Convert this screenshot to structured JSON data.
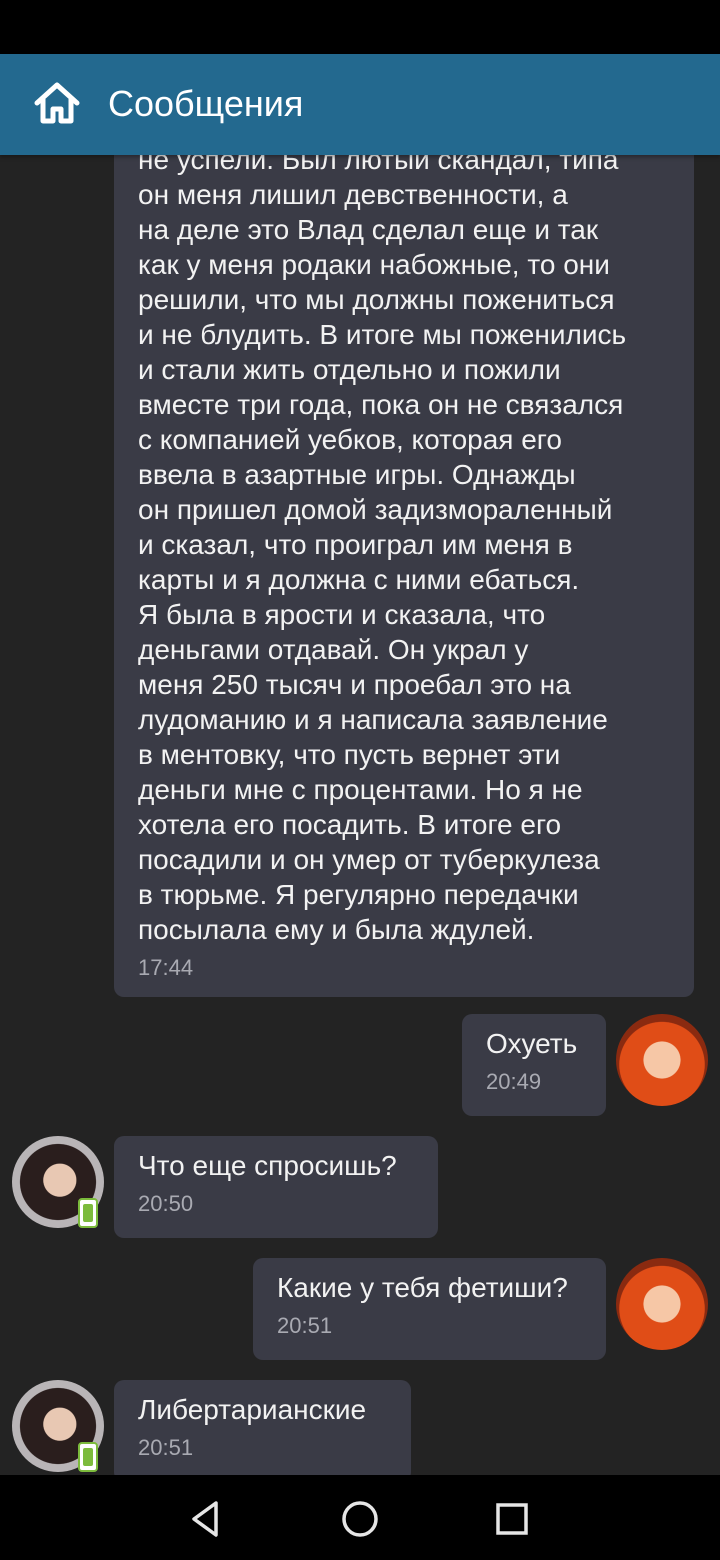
{
  "app_bar": {
    "title": "Сообщения",
    "icon": "home-icon"
  },
  "messages": [
    {
      "sender": "other",
      "text": "не успели. Был лютый скандал, типа\nон меня лишил девственности, а\nна деле это Влад сделал еще и так\nкак у меня родаки набожные, то они\nрешили, что мы должны пожениться\nи не блудить. В итоге мы поженились\nи стали жить отдельно и пожили\nвместе три года, пока он не связался\nс компанией уебков, которая его\nввела в азартные игры. Однажды\nон пришел домой задизмораленный\nи сказал, что проиграл им меня в\nкарты и я должна с ними ебаться.\nЯ была в ярости и сказала, что\nденьгами отдавай. Он украл у\nменя 250 тысяч и проебал это на\nлудоманию и я написала заявление\nв ментовку, что пусть вернет эти\nденьги мне с процентами. Но я не\nхотела его посадить. В итоге его\nпосадили и он умер от туберкулеза\nв тюрьме. Я регулярно передачки\nпосылала ему и была ждулей.",
      "time": "17:44"
    },
    {
      "sender": "me",
      "text": "Охуеть",
      "time": "20:49"
    },
    {
      "sender": "other",
      "text": "Что еще спросишь?",
      "time": "20:50"
    },
    {
      "sender": "me",
      "text": "Какие у тебя фетиши?",
      "time": "20:51"
    },
    {
      "sender": "other",
      "text": "Либертарианские",
      "time": "20:51"
    }
  ],
  "nav": {
    "back": "back-icon",
    "home": "home-circle-icon",
    "recents": "recents-icon"
  }
}
